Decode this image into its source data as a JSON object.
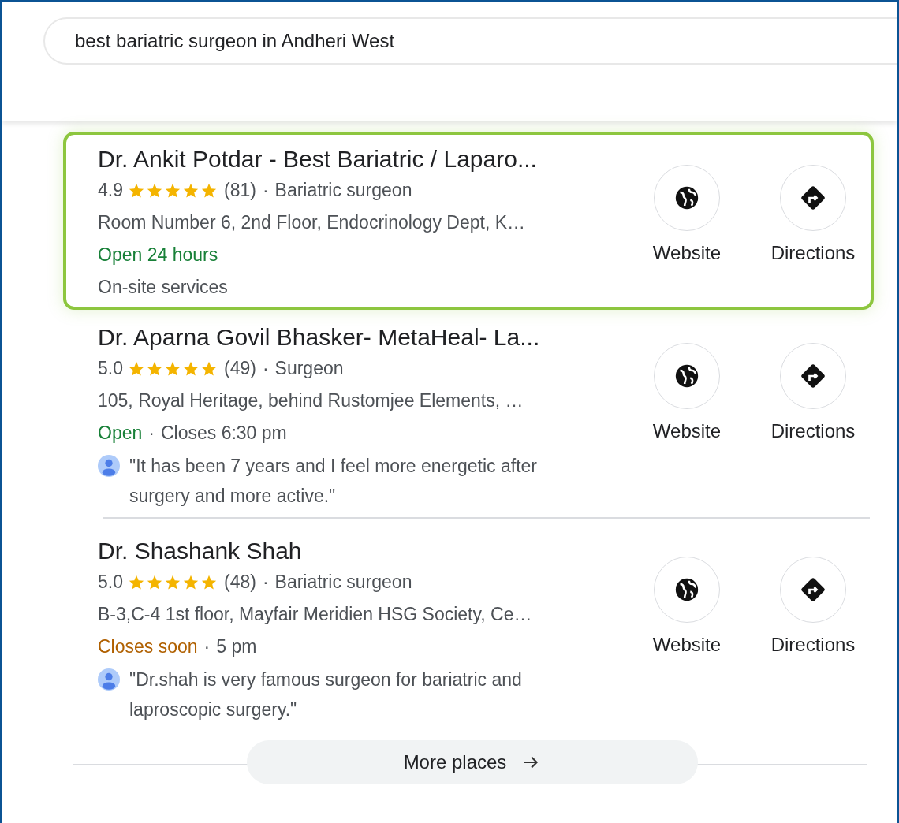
{
  "search": {
    "value": "best bariatric surgeon in Andheri West"
  },
  "listings": [
    {
      "name": "Dr. Ankit Potdar - Best Bariatric / Laparo...",
      "selected": true,
      "rating": "4.9",
      "stars": 5,
      "reviews": "(81)",
      "separator": "·",
      "category": "Bariatric surgeon",
      "address": "Room Number 6, 2nd Floor, Endocrinology Dept, K…",
      "status": {
        "kind": "open",
        "text": "Open 24 hours"
      },
      "extra": {
        "kind": "note",
        "text": "On-site services"
      },
      "actions": [
        "Website",
        "Directions"
      ]
    },
    {
      "name": "Dr. Aparna Govil Bhasker- MetaHeal- La...",
      "selected": false,
      "rating": "5.0",
      "stars": 5,
      "reviews": "(49)",
      "separator": "·",
      "category": "Surgeon",
      "address": "105, Royal Heritage, behind Rustomjee Elements, …",
      "status": {
        "kind": "open",
        "text": "Open",
        "separator": "·",
        "hours": "Closes 6:30 pm"
      },
      "extra": {
        "kind": "review",
        "text": "\"It has been 7 years and I feel more energetic after surgery and more active.\""
      },
      "actions": [
        "Website",
        "Directions"
      ]
    },
    {
      "name": "Dr. Shashank Shah",
      "selected": false,
      "rating": "5.0",
      "stars": 5,
      "reviews": "(48)",
      "separator": "·",
      "category": "Bariatric surgeon",
      "address": "B-3,C-4 1st floor, Mayfair Meridien HSG Society, Ce…",
      "status": {
        "kind": "closes_soon",
        "text": "Closes soon",
        "separator": "·",
        "hours": "5 pm"
      },
      "extra": {
        "kind": "review",
        "text": "\"Dr.shah is very famous surgeon for bariatric and laproscopic surgery.\""
      },
      "actions": [
        "Website",
        "Directions"
      ]
    }
  ],
  "more_button": {
    "label": "More places"
  }
}
